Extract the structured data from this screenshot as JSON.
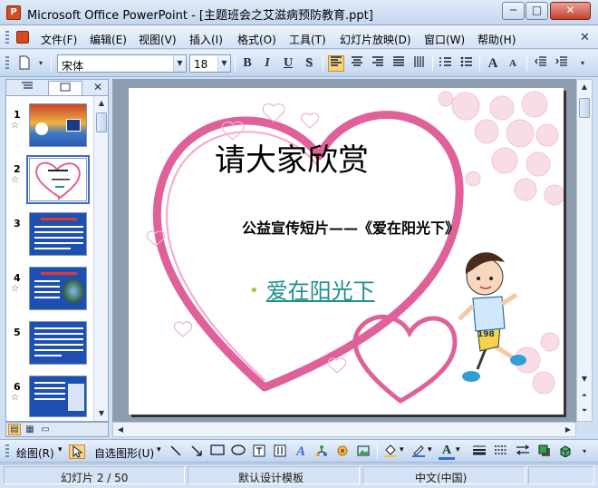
{
  "window": {
    "title": "Microsoft Office PowerPoint - [主题班会之艾滋病预防教育.ppt]",
    "app_icon_letter": "P",
    "minimize": "─",
    "maximize": "□",
    "close": "✕"
  },
  "menu": {
    "items": [
      "文件(F)",
      "编辑(E)",
      "视图(V)",
      "插入(I)",
      "格式(O)",
      "工具(T)",
      "幻灯片放映(D)",
      "窗口(W)",
      "帮助(H)"
    ],
    "close": "✕"
  },
  "toolbar": {
    "font_name": "宋体",
    "font_size": "18",
    "bold": "B",
    "italic": "I",
    "underline": "U",
    "shadow": "S",
    "grow_font": "A",
    "shrink_font": "A"
  },
  "outline_pane": {
    "tab_outline_icon": "outline-icon",
    "tab_slides_icon": "slides-icon",
    "close": "✕",
    "slides": [
      {
        "number": "1",
        "star": "☆"
      },
      {
        "number": "2",
        "star": "☆"
      },
      {
        "number": "3",
        "star": ""
      },
      {
        "number": "4",
        "star": "☆"
      },
      {
        "number": "5",
        "star": ""
      },
      {
        "number": "6",
        "star": "☆"
      }
    ],
    "selected_slide": 2
  },
  "slide": {
    "title": "请大家欣赏",
    "subtitle": "公益宣传短片——《爱在阳光下》",
    "bullet": "爱在阳光下",
    "bullet_marker": "•",
    "runner_number": "198",
    "heart_color": "#e0609a",
    "link_color": "#1f8e8e"
  },
  "drawbar": {
    "draw_label": "绘图(R)",
    "autoshapes_label": "自选图形(U)"
  },
  "status": {
    "slide_position": "幻灯片 2 / 50",
    "template": "默认设计模板",
    "language": "中文(中国)"
  },
  "colors": {
    "accent": "#fbd283",
    "chrome": "#c3d6ef"
  }
}
